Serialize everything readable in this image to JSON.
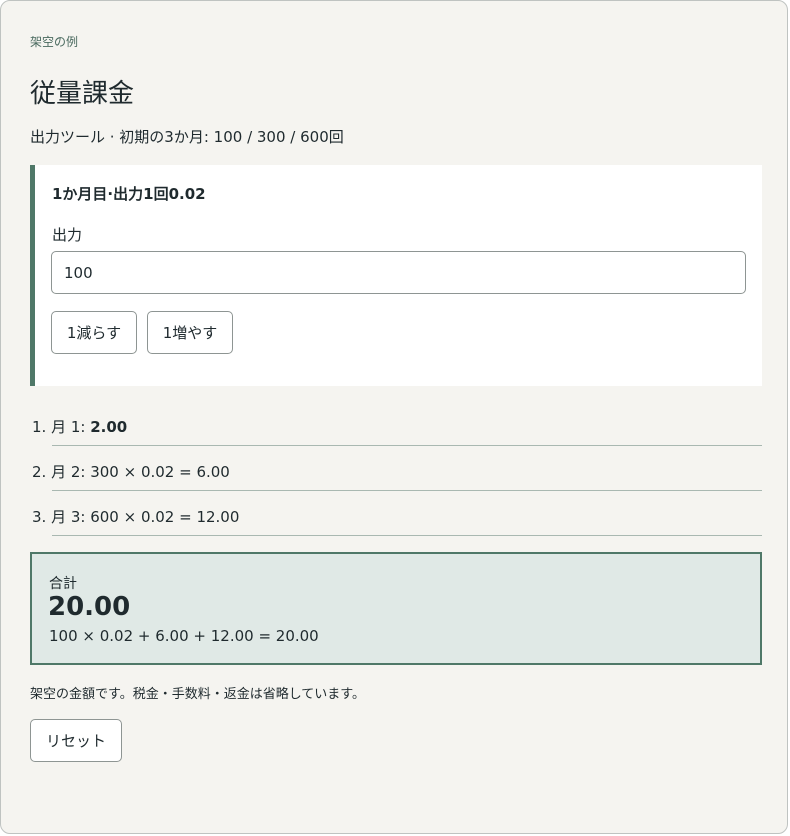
{
  "header": {
    "eyebrow": "架空の例",
    "title": "従量課金",
    "subtitle": "出力ツール · 初期の3か月: 100 / 300 / 600回"
  },
  "panel": {
    "heading": "1か月目·出力1回0.02",
    "field_label": "出力",
    "output_value": "100",
    "decrement_label": "1減らす",
    "increment_label": "1増やす"
  },
  "months": [
    {
      "prefix": "1. 月 1: ",
      "amount": "2.00"
    },
    {
      "text": "2. 月 2: 300 × 0.02 = 6.00"
    },
    {
      "text": "3. 月 3: 600 × 0.02 = 12.00"
    }
  ],
  "total": {
    "label": "合計",
    "value": "20.00",
    "formula": "100 × 0.02 + 6.00 + 12.00 = 20.00"
  },
  "footer": {
    "note": "架空の金額です。税金・手数料・返金は省略しています。",
    "reset_label": "リセット"
  },
  "colors": {
    "accent": "#4f7868",
    "total_background": "#e0e9e6",
    "card_background": "#f5f4f0"
  }
}
